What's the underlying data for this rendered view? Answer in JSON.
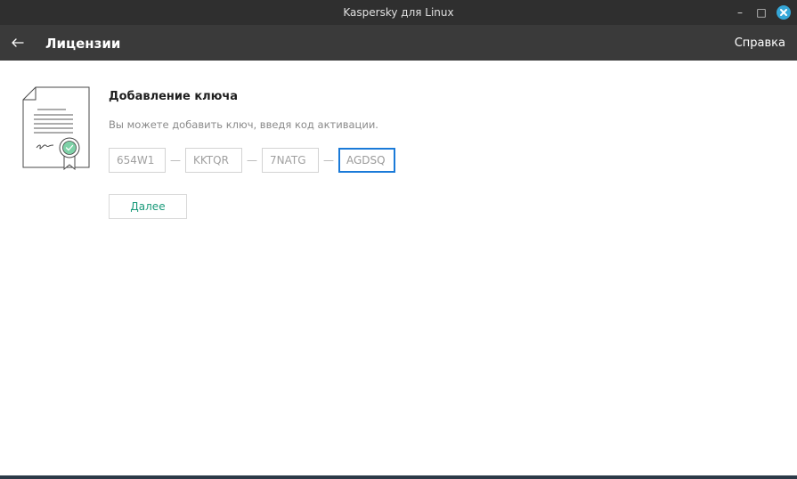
{
  "window": {
    "title": "Kaspersky для Linux",
    "minimize_glyph": "–",
    "maximize_glyph": "□",
    "close_icon": "close-icon",
    "accent_close": "#35a7d8"
  },
  "appbar": {
    "back_icon": "arrow-left-icon",
    "title": "Лицензии",
    "help_label": "Справка"
  },
  "content": {
    "illustration_icon": "license-document-icon",
    "title": "Добавление ключа",
    "description": "Вы можете добавить ключ, введя код активации.",
    "key_fields": [
      {
        "value": "654W1"
      },
      {
        "value": "KKTQR"
      },
      {
        "value": "7NATG"
      },
      {
        "value": "AGDSQ"
      }
    ],
    "separator": "—",
    "next_label": "Далее",
    "accent_color": "#1a9a7a",
    "focus_color": "#1a7ad8"
  }
}
